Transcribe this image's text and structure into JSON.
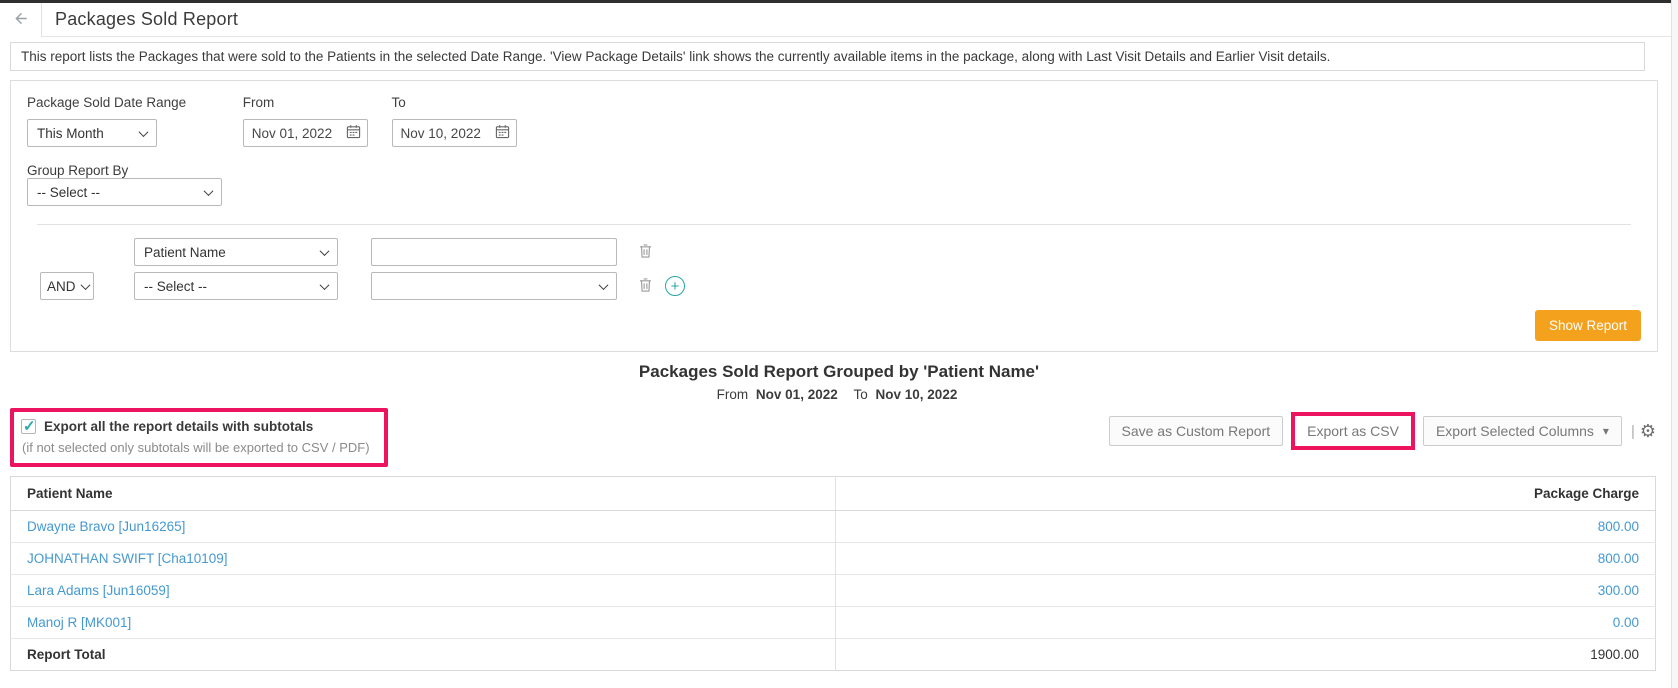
{
  "app": {
    "title": "Packages Sold Report"
  },
  "description": "This report lists the Packages that were sold to the Patients in the selected Date Range. 'View Package Details' link shows the currently available items in the package, along with Last Visit Details and Earlier Visit details.",
  "filters": {
    "date_range": {
      "label": "Package Sold Date Range",
      "selected": "This Month"
    },
    "from": {
      "label": "From",
      "value": "Nov 01, 2022"
    },
    "to": {
      "label": "To",
      "value": "Nov 10, 2022"
    },
    "group_by": {
      "label": "Group Report By",
      "selected": "-- Select --"
    },
    "conditions": [
      {
        "field": "Patient Name",
        "value": ""
      },
      {
        "operator": "AND",
        "field": "-- Select --",
        "value": ""
      }
    ],
    "show_report": "Show Report"
  },
  "report": {
    "title": "Packages Sold Report Grouped by 'Patient Name'",
    "range": {
      "from_label": "From",
      "from": "Nov 01, 2022",
      "to_label": "To",
      "to": "Nov 10, 2022"
    }
  },
  "export": {
    "subtotals_checkbox": {
      "label": "Export all the report details with subtotals",
      "checked": true
    },
    "note": "(if not selected only subtotals will be exported to CSV / PDF)",
    "save_custom": "Save as Custom Report",
    "export_csv": "Export as CSV",
    "export_columns": "Export Selected Columns"
  },
  "table": {
    "columns": {
      "patient": "Patient Name",
      "charge": "Package Charge"
    },
    "rows": [
      {
        "patient": "Dwayne Bravo [Jun16265]",
        "charge": "800.00"
      },
      {
        "patient": "JOHNATHAN SWIFT [Cha10109]",
        "charge": "800.00"
      },
      {
        "patient": "Lara Adams [Jun16059]",
        "charge": "300.00"
      },
      {
        "patient": "Manoj R [MK001]",
        "charge": "0.00"
      }
    ],
    "total": {
      "label": "Report Total",
      "value": "1900.00"
    }
  },
  "icons": {
    "gear": "⚙",
    "caret_down": "▾",
    "plus": "+",
    "separator": "|"
  },
  "colors": {
    "accent_orange": "#f4a11d",
    "annotation_pink": "#ec135f",
    "link_blue": "#4599d1",
    "teal": "#29a8a3"
  }
}
